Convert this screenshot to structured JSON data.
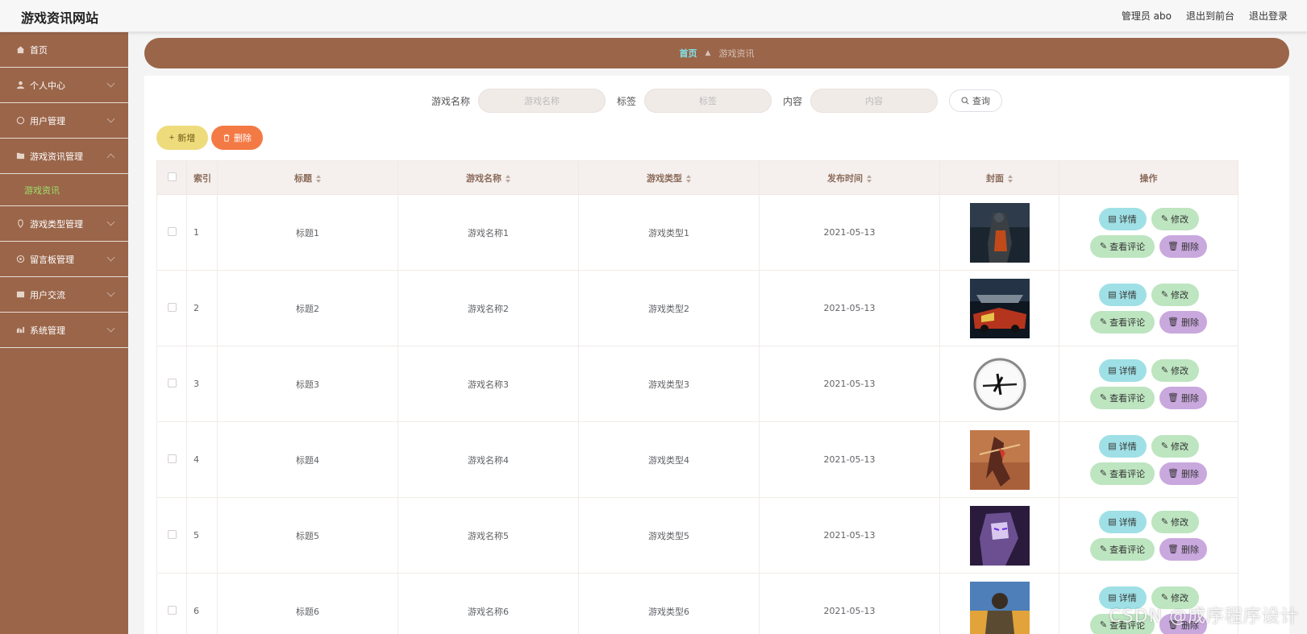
{
  "header": {
    "site_title": "游戏资讯网站",
    "user_label": "管理员 abo",
    "back_frontend": "退出到前台",
    "logout": "退出登录"
  },
  "sidebar": {
    "items": [
      {
        "label": "首页",
        "icon": "home-icon"
      },
      {
        "label": "个人中心",
        "icon": "user-icon"
      },
      {
        "label": "用户管理",
        "icon": "users-icon"
      },
      {
        "label": "游戏资讯管理",
        "icon": "folder-icon"
      },
      {
        "label": "游戏类型管理",
        "icon": "tag-icon"
      },
      {
        "label": "留言板管理",
        "icon": "message-icon"
      },
      {
        "label": "用户交流",
        "icon": "chat-icon"
      },
      {
        "label": "系统管理",
        "icon": "settings-icon"
      }
    ],
    "active_sub": "游戏资讯"
  },
  "breadcrumb": {
    "home": "首页",
    "current": "游戏资讯"
  },
  "search": {
    "name_label": "游戏名称",
    "name_placeholder": "游戏名称",
    "tag_label": "标签",
    "tag_placeholder": "标签",
    "content_label": "内容",
    "content_placeholder": "内容",
    "button": "查询"
  },
  "actions": {
    "add": "新增",
    "delete": "删除"
  },
  "table": {
    "headers": {
      "index": "索引",
      "title": "标题",
      "game_name": "游戏名称",
      "game_type": "游戏类型",
      "publish_time": "发布时间",
      "cover": "封面",
      "ops": "操作"
    },
    "op_labels": {
      "detail": "详情",
      "edit": "修改",
      "comment": "查看评论",
      "delete": "删除"
    },
    "rows": [
      {
        "index": "1",
        "title": "标题1",
        "game_name": "游戏名称1",
        "game_type": "游戏类型1",
        "publish_time": "2021-05-13"
      },
      {
        "index": "2",
        "title": "标题2",
        "game_name": "游戏名称2",
        "game_type": "游戏类型2",
        "publish_time": "2021-05-13"
      },
      {
        "index": "3",
        "title": "标题3",
        "game_name": "游戏名称3",
        "game_type": "游戏类型3",
        "publish_time": "2021-05-13"
      },
      {
        "index": "4",
        "title": "标题4",
        "game_name": "游戏名称4",
        "game_type": "游戏类型4",
        "publish_time": "2021-05-13"
      },
      {
        "index": "5",
        "title": "标题5",
        "game_name": "游戏名称5",
        "game_type": "游戏类型5",
        "publish_time": "2021-05-13"
      },
      {
        "index": "6",
        "title": "标题6",
        "game_name": "游戏名称6",
        "game_type": "游戏类型6",
        "publish_time": "2021-05-13"
      }
    ]
  },
  "watermark": "CSDN @成序程序设计",
  "colors": {
    "sidebar": "#9a6549",
    "breadcrumb_home": "#7fe3ea",
    "active_sub": "#9de06a",
    "add_button": "#eedb7c",
    "delete_button": "#f47a45"
  }
}
